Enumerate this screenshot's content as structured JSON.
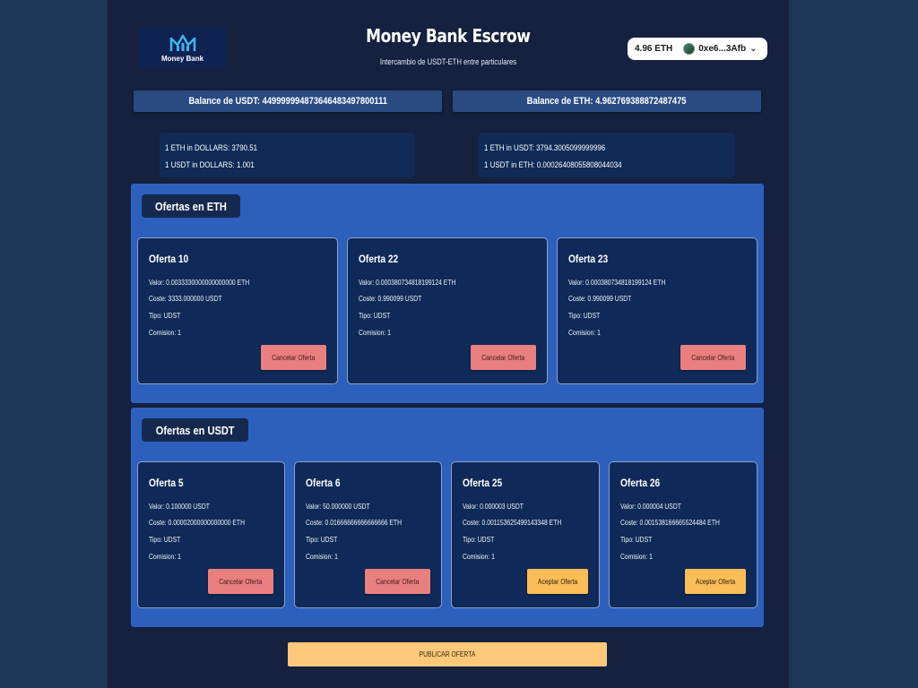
{
  "header": {
    "logo_text": "Money Bank",
    "title": "Money Bank Escrow",
    "subtitle": "Intercambio de USDT-ETH entre particulares"
  },
  "wallet": {
    "eth_balance": "4.96 ETH",
    "address": "0xe6...3Afb"
  },
  "balances": {
    "usdt": "Balance de USDT: 449999994873646483497800111",
    "eth": "Balance de ETH: 4.962769388872487475"
  },
  "rates": {
    "left": [
      "1 ETH in DOLLARS: 3790.51",
      "1 USDT in DOLLARS: 1.001"
    ],
    "right": [
      "1 ETH in USDT: 3794.3005099999996",
      "1 USDT in ETH: 0.00026408055808044034"
    ]
  },
  "sections": {
    "eth": {
      "title": "Ofertas en ETH",
      "cards": [
        {
          "title": "Oferta 10",
          "valor": "Valor: 0.0033330000000000000 ETH",
          "coste": "Coste: 3333.000000 USDT",
          "tipo": "Tipo: UDST",
          "comision": "Comision: 1",
          "button": "Cancelar Oferta"
        },
        {
          "title": "Oferta 22",
          "valor": "Valor: 0.000380734818199124 ETH",
          "coste": "Coste: 0.990099 USDT",
          "tipo": "Tipo: UDST",
          "comision": "Comision: 1",
          "button": "Cancelar Oferta"
        },
        {
          "title": "Oferta 23",
          "valor": "Valor: 0.000380734818199124 ETH",
          "coste": "Coste: 0.990099 USDT",
          "tipo": "Tipo: UDST",
          "comision": "Comision: 1",
          "button": "Cancelar Oferta"
        }
      ]
    },
    "usdt": {
      "title": "Ofertas en USDT",
      "cards": [
        {
          "title": "Oferta 5",
          "valor": "Valor: 0.100000 USDT",
          "coste": "Coste: 0.00002000000000000 ETH",
          "tipo": "Tipo: UDST",
          "comision": "Comision: 1",
          "button": "Cancelar Oferta"
        },
        {
          "title": "Oferta 6",
          "valor": "Valor: 50.000000 USDT",
          "coste": "Coste: 0.01666666666666666 ETH",
          "tipo": "Tipo: UDST",
          "comision": "Comision: 1",
          "button": "Cancelar Oferta"
        },
        {
          "title": "Oferta 25",
          "valor": "Valor: 0.000003 USDT",
          "coste": "Coste: 0.001153625499143348 ETH",
          "tipo": "Tipo: UDST",
          "comision": "Comision: 1",
          "button": "Aceptar Oferta"
        },
        {
          "title": "Oferta 26",
          "valor": "Valor: 0.000004 USDT",
          "coste": "Coste: 0.001538166665524484 ETH",
          "tipo": "Tipo: UDST",
          "comision": "Comision: 1",
          "button": "Aceptar Oferta"
        }
      ]
    }
  },
  "publish_label": "PUBLICAR OFERTA",
  "colors": {
    "page_bg": "#1d3557",
    "app_bg": "#15213f",
    "section_bg": "#2d5fbd",
    "card_bg": "#0f2a58",
    "cancel_btn": "#ea7f7f",
    "accept_btn": "#fbbd58",
    "publish_btn": "#fdc87a"
  }
}
